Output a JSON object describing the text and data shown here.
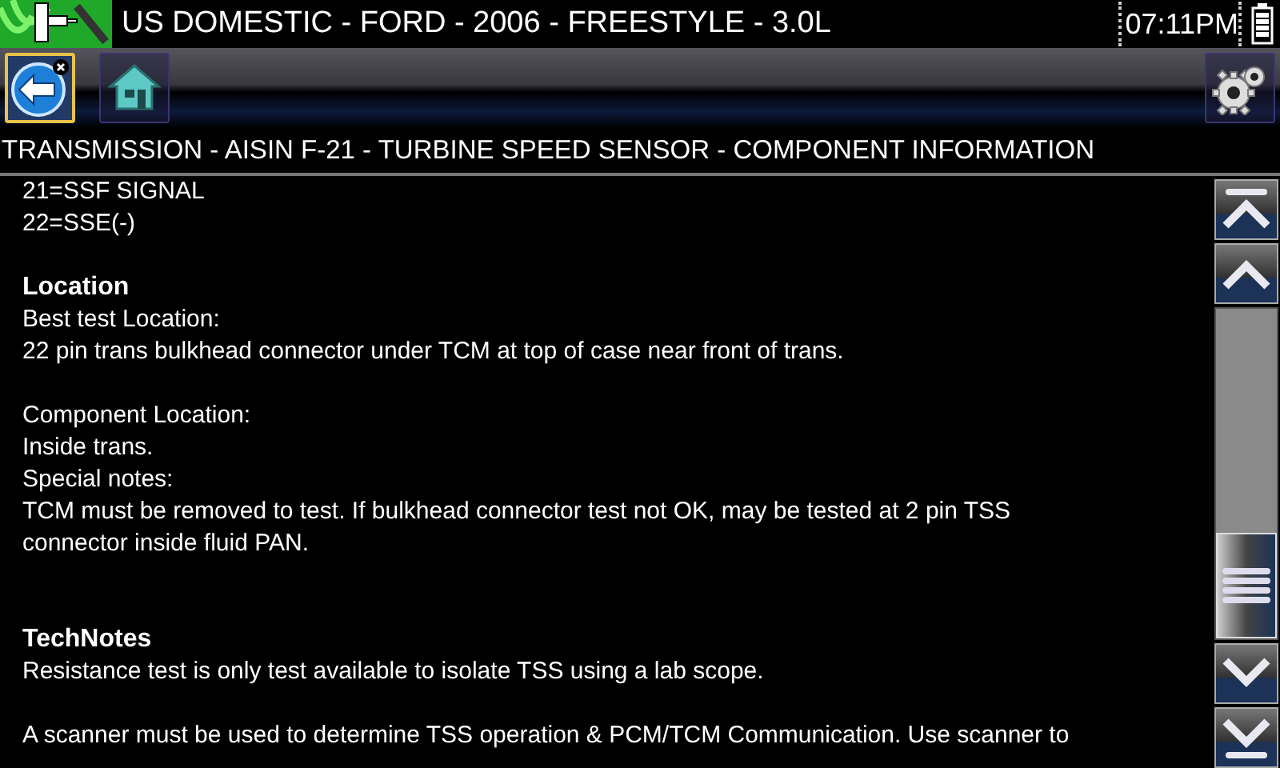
{
  "status_bar": {
    "title": "US DOMESTIC - FORD - 2006 - FREESTYLE - 3.0L",
    "time": "07:11PM"
  },
  "toolbar": {
    "buttons": [
      {
        "kind": "back",
        "selected": true
      },
      {
        "kind": "home",
        "selected": false
      },
      {
        "kind": "settings",
        "selected": false
      }
    ]
  },
  "breadcrumb": "TRANSMISSION - AISIN F-21 - TURBINE SPEED SENSOR - COMPONENT INFORMATION",
  "sections": [
    {
      "paragraphs": [
        [
          "21=SSF SIGNAL",
          "22=SSE(-)"
        ]
      ]
    },
    {
      "heading": "Location",
      "paragraphs": [
        [
          "Best test Location:",
          "22 pin trans bulkhead connector under TCM at top of case near front of trans."
        ],
        [
          "Component Location:",
          "Inside trans.",
          "Special notes:",
          "TCM must be removed to test.  If bulkhead connector test not OK, may be tested at 2 pin TSS",
          "connector inside fluid PAN."
        ]
      ]
    },
    {
      "heading": "TechNotes",
      "paragraphs": [
        [
          "Resistance test is only test available to isolate TSS using a lab scope."
        ],
        [
          "A scanner must be used to determine TSS operation & PCM/TCM Communication. Use scanner to"
        ]
      ]
    }
  ]
}
